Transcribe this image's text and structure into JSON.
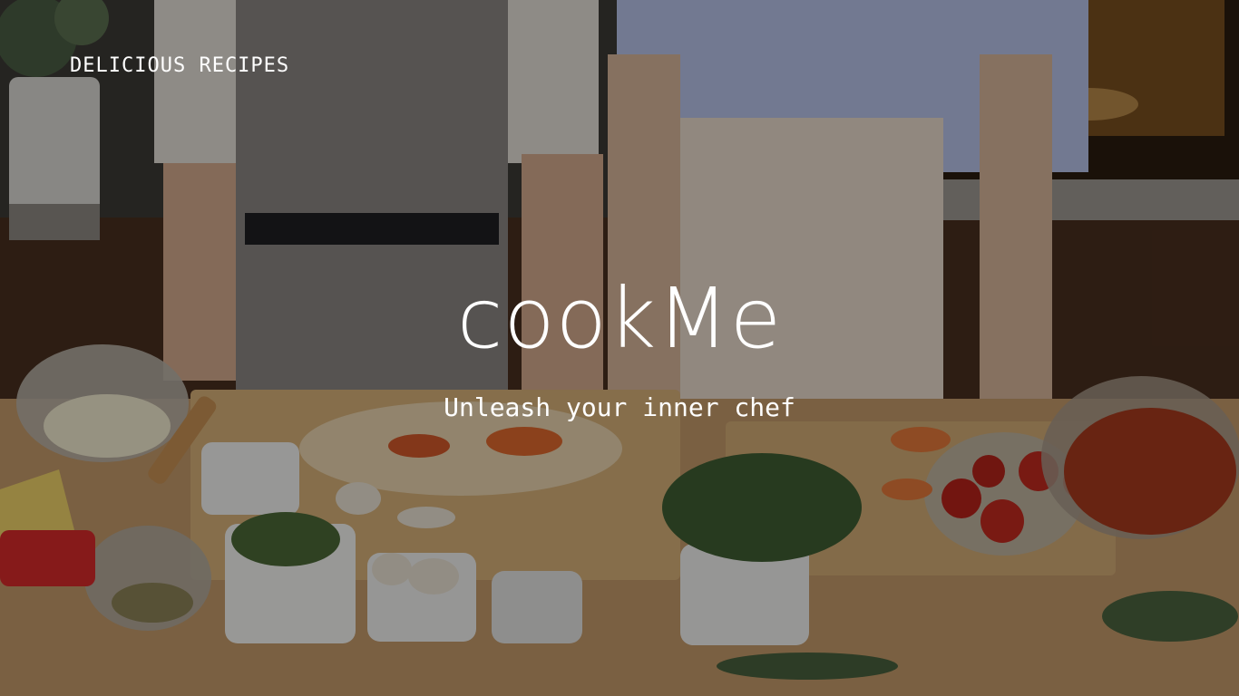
{
  "header": {
    "brand_tag": "DELICIOUS RECIPES"
  },
  "hero": {
    "title": "cookMe",
    "subtitle": "Unleash your inner chef",
    "background_image": "kitchen-cooking-photo",
    "overlay_color": "#000000"
  },
  "colors": {
    "text": "#ffffff",
    "wood": "#8a6a45",
    "tomato": "#c0392b",
    "herb": "#3f6a3a"
  }
}
